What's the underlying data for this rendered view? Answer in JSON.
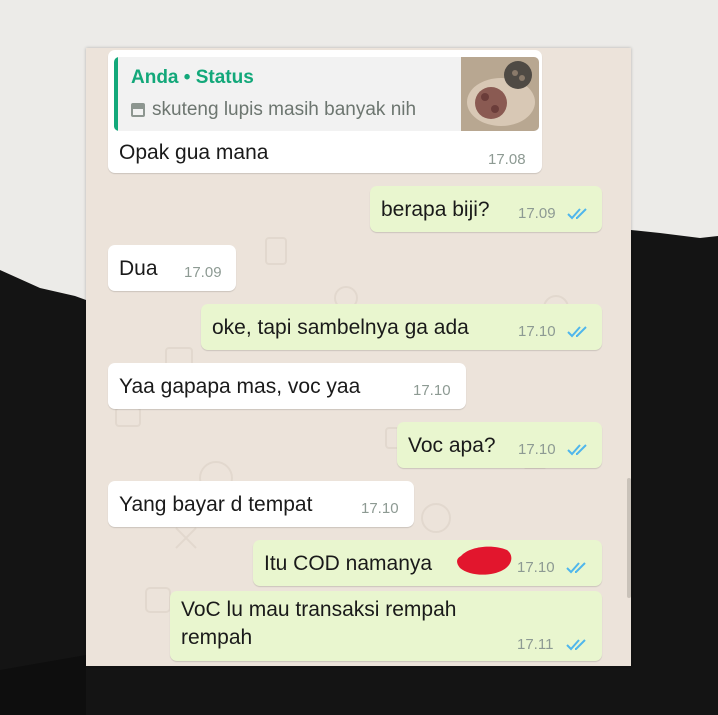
{
  "reply_context": {
    "title": "Anda • Status",
    "text": "skuteng lupis masih banyak nih"
  },
  "messages": [
    {
      "dir": "in",
      "text": "Opak gua mana",
      "time": "17.08"
    },
    {
      "dir": "out",
      "text": "berapa biji?",
      "time": "17.09"
    },
    {
      "dir": "in",
      "text": "Dua",
      "time": "17.09"
    },
    {
      "dir": "out",
      "text": "oke, tapi sambelnya ga ada",
      "time": "17.10"
    },
    {
      "dir": "in",
      "text": "Yaa gapapa mas, voc yaa",
      "time": "17.10"
    },
    {
      "dir": "out",
      "text": "Voc apa?",
      "time": "17.10"
    },
    {
      "dir": "in",
      "text": "Yang bayar d tempat",
      "time": "17.10"
    },
    {
      "dir": "out",
      "text": "Itu COD namanya",
      "time": "17.10"
    },
    {
      "dir": "out",
      "text_line1": "VoC lu mau transaksi rempah",
      "text_line2": "rempah",
      "time": "17.11"
    }
  ],
  "colors": {
    "incoming_bubble": "#ffffff",
    "outgoing_bubble": "#e9f6cf",
    "read_ticks": "#4fb6ec",
    "quote_accent": "#13a87a",
    "redaction": "#e2162d"
  },
  "icons": [
    "image-icon",
    "double-check-icon"
  ]
}
